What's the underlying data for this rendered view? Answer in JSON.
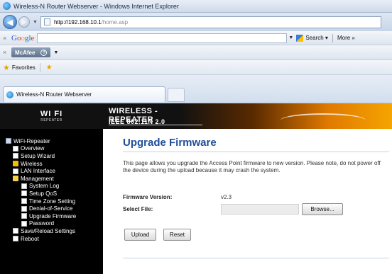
{
  "browser": {
    "window_title": "Wireless-N Router Webserver - Windows Internet Explorer",
    "url_host": "http://192.168.10.1",
    "url_path": "/home.asp",
    "google_label": "Google",
    "search_label": "Search",
    "more_label": "More »",
    "mcafee_label": "McAfee",
    "favorites_label": "Favorites",
    "tab_title": "Wireless-N Router Webserver"
  },
  "header": {
    "logo_main": "WI FI",
    "logo_sub": "REPEATER",
    "product_title": "WIRELESS - REPEATER",
    "product_sub": "IEEE 802.11N 2.0"
  },
  "sidebar": {
    "items": [
      {
        "label": "WiFi-Repeater",
        "icon": "computer-icon",
        "level": 0
      },
      {
        "label": "Overview",
        "icon": "page-icon",
        "level": 1
      },
      {
        "label": "Setup Wizard",
        "icon": "page-icon",
        "level": 1
      },
      {
        "label": "Wireless",
        "icon": "folder-icon",
        "level": 1
      },
      {
        "label": "LAN Interface",
        "icon": "page-icon",
        "level": 1
      },
      {
        "label": "Management",
        "icon": "folder-open-icon",
        "level": 1
      },
      {
        "label": "System Log",
        "icon": "page-icon",
        "level": 2
      },
      {
        "label": "Setup QoS",
        "icon": "page-icon",
        "level": 2
      },
      {
        "label": "Time Zone Setting",
        "icon": "page-icon",
        "level": 2
      },
      {
        "label": "Denial-of-Service",
        "icon": "page-icon",
        "level": 2
      },
      {
        "label": "Upgrade Firmware",
        "icon": "page-icon",
        "level": 2
      },
      {
        "label": "Password",
        "icon": "page-icon",
        "level": 2
      },
      {
        "label": "Save/Reload Settings",
        "icon": "page-icon",
        "level": 1
      },
      {
        "label": "Reboot",
        "icon": "page-icon",
        "level": 1
      }
    ]
  },
  "main": {
    "title": "Upgrade Firmware",
    "description": "This page allows you upgrade the Access Point firmware to new version. Please note, do not power off the device during the upload because it may crash the system.",
    "firmware_version_label": "Firmware Version:",
    "firmware_version_value": "v2.3",
    "select_file_label": "Select File:",
    "browse_label": "Browse...",
    "upload_label": "Upload",
    "reset_label": "Reset"
  },
  "colors": {
    "title_blue": "#1f4f9a",
    "sidebar_bg": "#000000",
    "header_orange": "#f5a400"
  }
}
